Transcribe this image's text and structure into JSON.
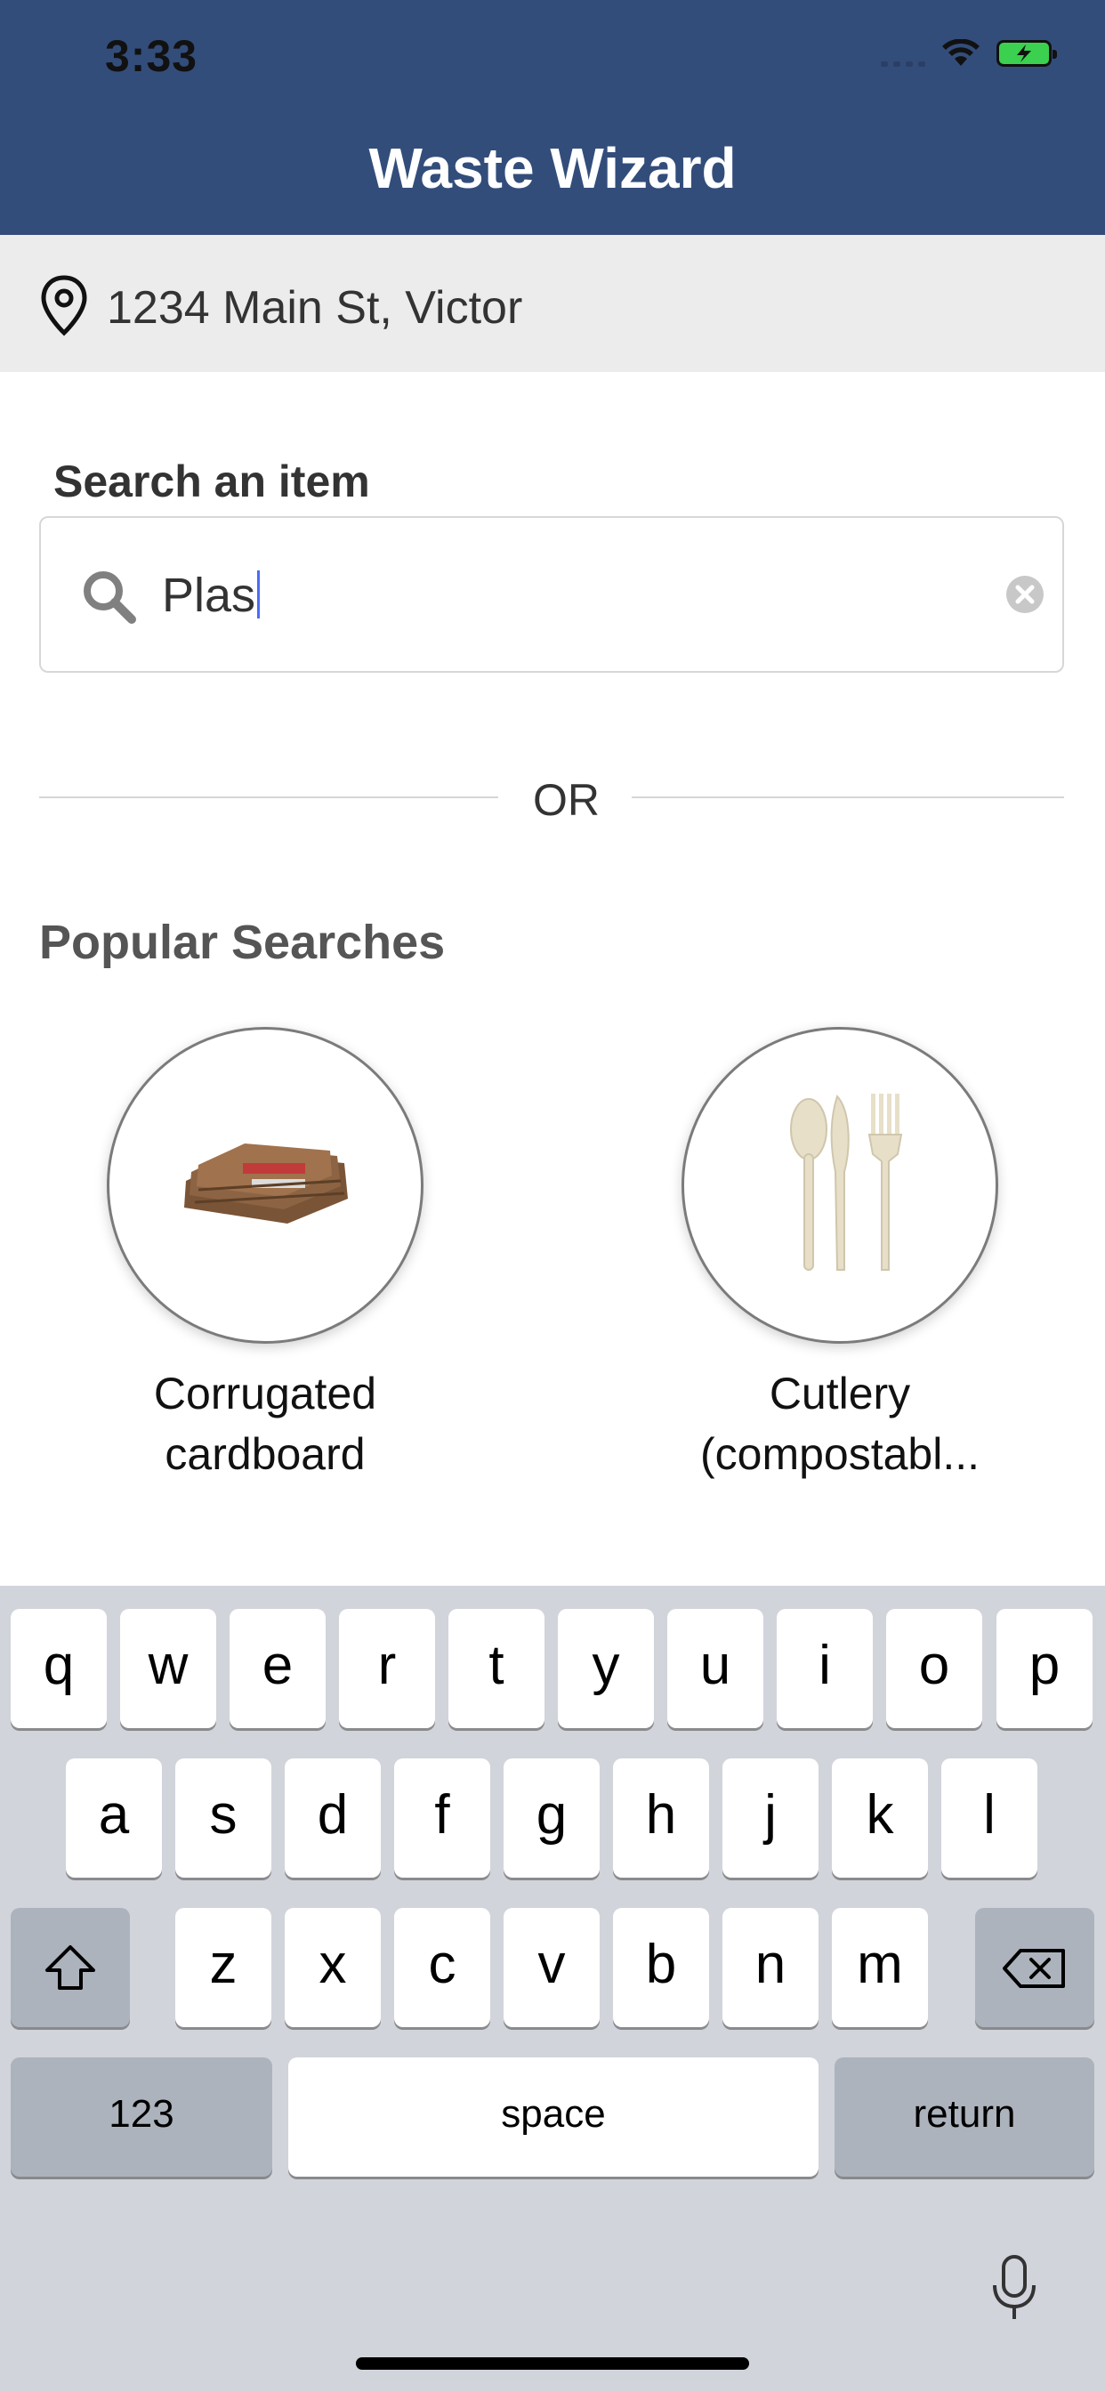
{
  "status_bar": {
    "time": "3:33"
  },
  "header": {
    "title": "Waste Wizard"
  },
  "location": {
    "address": "1234 Main St, Victor"
  },
  "search": {
    "label": "Search an item",
    "value": "Plas"
  },
  "divider": {
    "text": "OR"
  },
  "popular": {
    "title": "Popular Searches",
    "items": [
      {
        "line1": "Corrugated",
        "line2": "cardboard"
      },
      {
        "line1": "Cutlery",
        "line2": "(compostabl..."
      }
    ]
  },
  "keyboard": {
    "row1": [
      "q",
      "w",
      "e",
      "r",
      "t",
      "y",
      "u",
      "i",
      "o",
      "p"
    ],
    "row2": [
      "a",
      "s",
      "d",
      "f",
      "g",
      "h",
      "j",
      "k",
      "l"
    ],
    "row3": [
      "z",
      "x",
      "c",
      "v",
      "b",
      "n",
      "m"
    ],
    "numbers_label": "123",
    "space_label": "space",
    "return_label": "return"
  },
  "colors": {
    "header_bg": "#334d7b",
    "keyboard_bg": "#d1d4da",
    "battery": "#3bd04f"
  }
}
